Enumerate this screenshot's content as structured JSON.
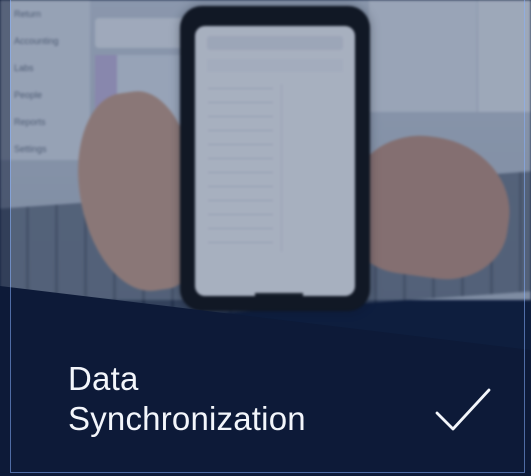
{
  "background": {
    "menu_items": [
      "Return",
      "Accounting",
      "Labs",
      "People",
      "Reports",
      "Settings"
    ]
  },
  "feature": {
    "title": "Data\nSynchronization",
    "icon": "checkmark-icon"
  },
  "colors": {
    "panel": "#0d1a38",
    "text": "#f3f6fb",
    "accent_border": "#87b0ff"
  }
}
